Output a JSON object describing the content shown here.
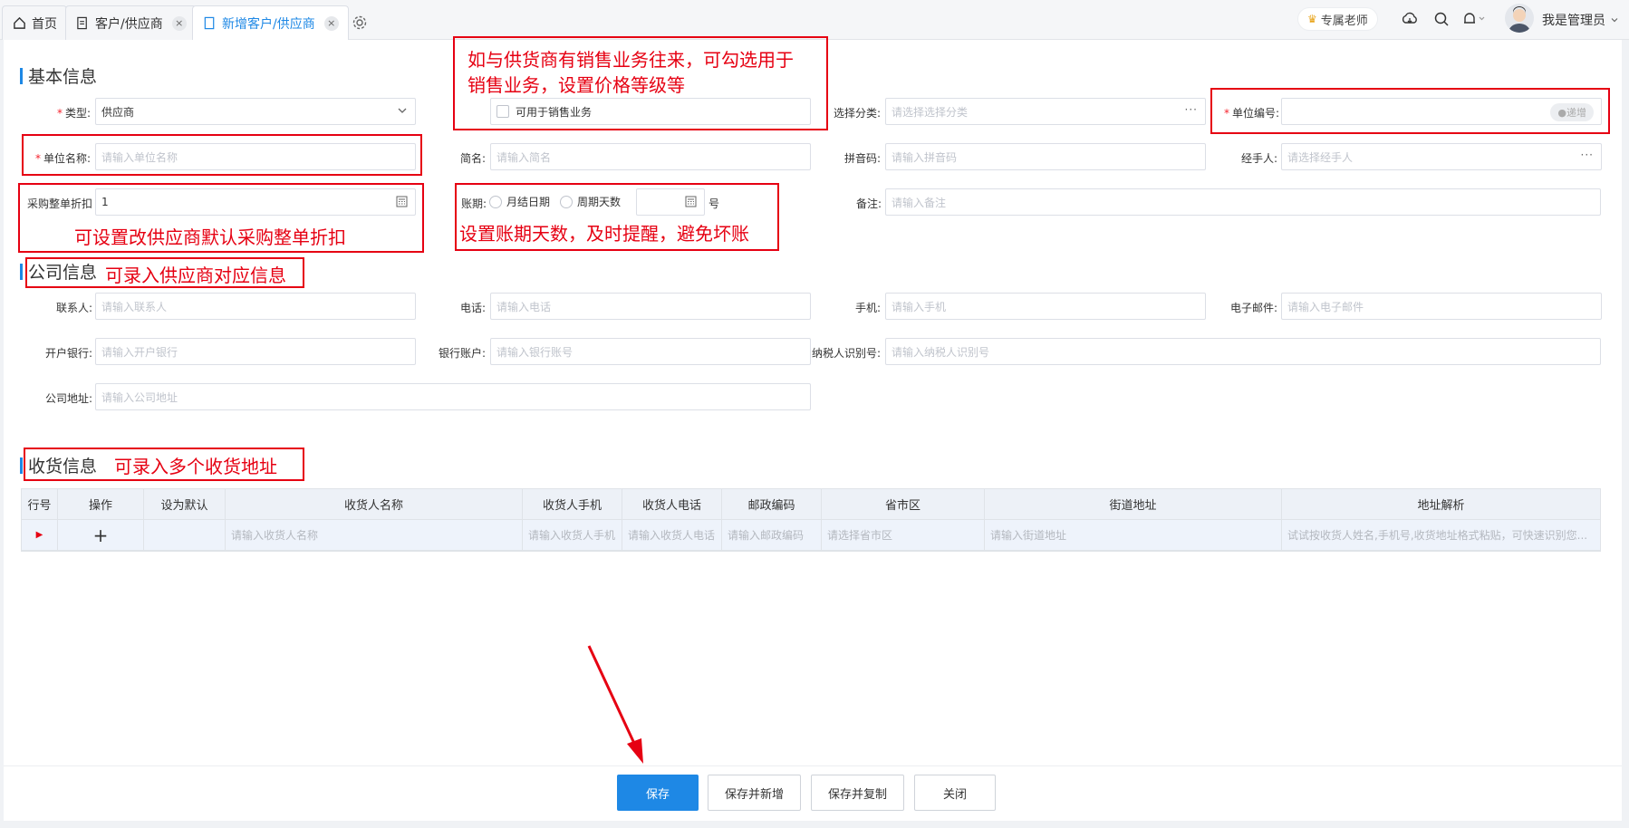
{
  "tabs": [
    {
      "label": "首页"
    },
    {
      "label": "客户/供应商"
    },
    {
      "label": "新增客户/供应商"
    }
  ],
  "header": {
    "teacher_label": "专属老师",
    "user_name": "我是管理员"
  },
  "sections": {
    "basic": "基本信息",
    "company": "公司信息",
    "delivery": "收货信息"
  },
  "basic": {
    "type_label": "类型:",
    "type_value": "供应商",
    "sales_checkbox": "可用于销售业务",
    "category_label": "选择分类:",
    "category_placeholder": "请选择选择分类",
    "code_label": "单位编号:",
    "code_pill": "递增",
    "name_label": "单位名称:",
    "name_placeholder": "请输入单位名称",
    "short_label": "简名:",
    "short_placeholder": "请输入简名",
    "pinyin_label": "拼音码:",
    "pinyin_placeholder": "请输入拼音码",
    "handler_label": "经手人:",
    "handler_placeholder": "请选择经手人",
    "discount_label": "采购整单折扣",
    "discount_value": "1",
    "period_label": "账期:",
    "period_opt1": "月结日期",
    "period_opt2": "周期天数",
    "period_suffix": "号",
    "remark_label": "备注:",
    "remark_placeholder": "请输入备注"
  },
  "company": {
    "contact_label": "联系人:",
    "contact_placeholder": "请输入联系人",
    "phone_label": "电话:",
    "phone_placeholder": "请输入电话",
    "mobile_label": "手机:",
    "mobile_placeholder": "请输入手机",
    "email_label": "电子邮件:",
    "email_placeholder": "请输入电子邮件",
    "bank_label": "开户银行:",
    "bank_placeholder": "请输入开户银行",
    "account_label": "银行账户:",
    "account_placeholder": "请输入银行账号",
    "taxid_label": "纳税人识别号:",
    "taxid_placeholder": "请输入纳税人识别号",
    "address_label": "公司地址:",
    "address_placeholder": "请输入公司地址"
  },
  "table": {
    "headers": [
      "行号",
      "操作",
      "设为默认",
      "收货人名称",
      "收货人手机",
      "收货人电话",
      "邮政编码",
      "省市区",
      "街道地址",
      "地址解析"
    ],
    "row": {
      "add": "+",
      "name": "请输入收货人名称",
      "mobile": "请输入收货人手机",
      "phone": "请输入收货人电话",
      "zip": "请输入邮政编码",
      "region": "请选择省市区",
      "street": "请输入街道地址",
      "parse": "试试按收货人姓名,手机号,收货地址格式粘贴，可快速识别您..."
    }
  },
  "annotations": {
    "sales": "如与供货商有销售业务往来，可勾选用于销售业务，设置价格等级等",
    "sales_line1": "如与供货商有销售业务往来，可勾选用于",
    "sales_line2": "销售业务，设置价格等级等",
    "discount": "可设置改供应商默认采购整单折扣",
    "period": "设置账期天数，及时提醒，避免坏账",
    "company": "可录入供应商对应信息",
    "delivery": "可录入多个收货地址"
  },
  "buttons": {
    "save": "保存",
    "save_new": "保存并新增",
    "save_copy": "保存并复制",
    "close": "关闭"
  },
  "colors": {
    "accent": "#1e88e5",
    "annotation": "#e60012"
  }
}
